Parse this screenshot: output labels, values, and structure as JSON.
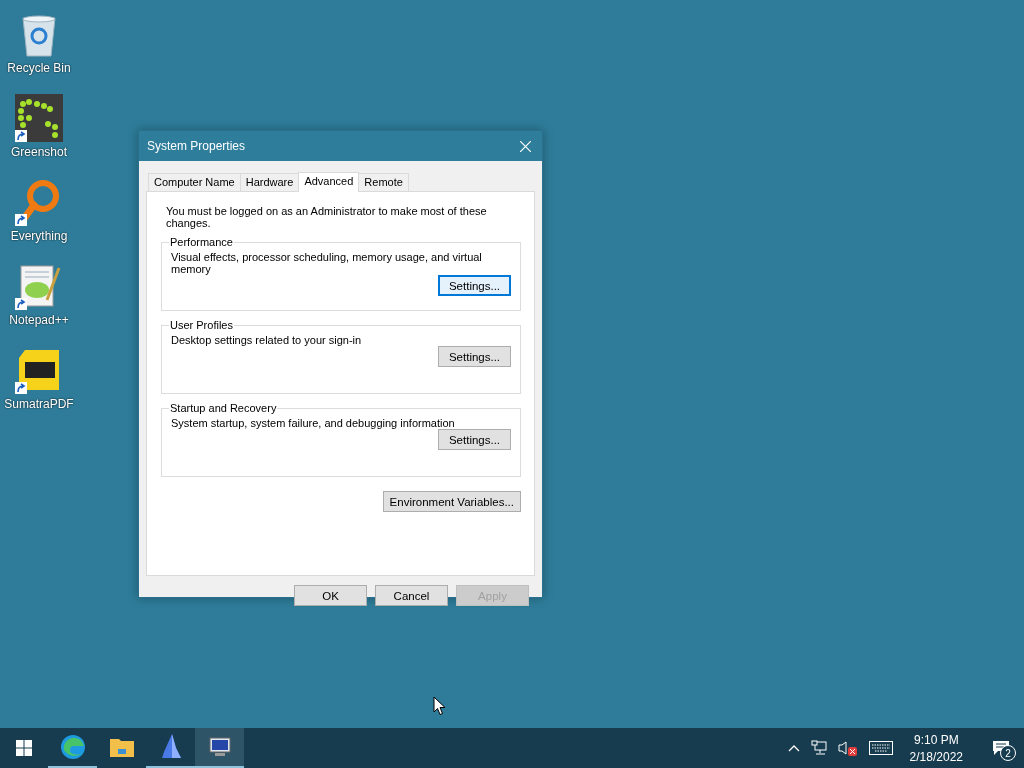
{
  "desktop_icons": [
    {
      "label": "Recycle Bin",
      "kind": "recycle",
      "shortcut": false
    },
    {
      "label": "Greenshot",
      "kind": "greenshot",
      "shortcut": true
    },
    {
      "label": "Everything",
      "kind": "everything",
      "shortcut": true
    },
    {
      "label": "Notepad++",
      "kind": "notepad",
      "shortcut": true
    },
    {
      "label": "SumatraPDF",
      "kind": "pdf",
      "shortcut": true
    }
  ],
  "window": {
    "title": "System Properties",
    "tabs": [
      {
        "label": "Computer Name",
        "selected": false
      },
      {
        "label": "Hardware",
        "selected": false
      },
      {
        "label": "Advanced",
        "selected": true
      },
      {
        "label": "Remote",
        "selected": false
      }
    ],
    "notice": "You must be logged on as an Administrator to make most of these changes.",
    "groups": [
      {
        "title": "Performance",
        "description": "Visual effects, processor scheduling, memory usage, and virtual memory",
        "button": "Settings...",
        "focused": true
      },
      {
        "title": "User Profiles",
        "description": "Desktop settings related to your sign-in",
        "button": "Settings...",
        "focused": false
      },
      {
        "title": "Startup and Recovery",
        "description": "System startup, system failure, and debugging information",
        "button": "Settings...",
        "focused": false
      }
    ],
    "env_button": "Environment Variables...",
    "buttons": [
      {
        "label": "OK",
        "disabled": false
      },
      {
        "label": "Cancel",
        "disabled": false
      },
      {
        "label": "Apply",
        "disabled": true
      }
    ]
  },
  "taskbar": {
    "apps": [
      {
        "kind": "edge",
        "running": true,
        "active": false
      },
      {
        "kind": "folder",
        "running": false,
        "active": false
      },
      {
        "kind": "flame",
        "running": true,
        "active": false
      },
      {
        "kind": "sysprops",
        "running": true,
        "active": true
      }
    ],
    "time": "9:10 PM",
    "date": "2/18/2022",
    "notification_count": "2"
  }
}
